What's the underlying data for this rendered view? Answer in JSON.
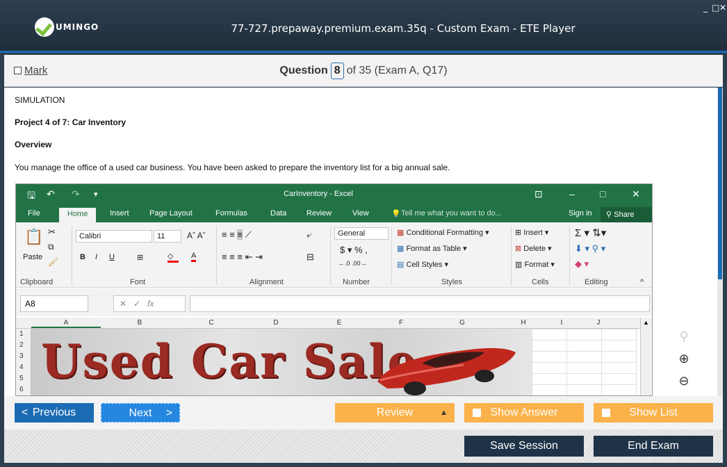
{
  "app": {
    "logo_text": "UMINGO",
    "title": "77-727.prepaway.premium.exam.35q - Custom Exam - ETE Player",
    "window_controls": [
      "_",
      "□",
      "✕"
    ]
  },
  "question_header": {
    "mark_label": "Mark",
    "question_word": "Question",
    "current": "8",
    "rest": "of 35 (Exam A, Q17)"
  },
  "content": {
    "type_label": "SIMULATION",
    "project_title": "Project 4 of 7: Car Inventory",
    "overview_heading": "Overview",
    "overview_text": "You manage the office of a used car business. You have been asked to prepare the inventory list for a big annual sale."
  },
  "excel": {
    "doc_title": "CarInventory - Excel",
    "tabs": [
      "File",
      "Home",
      "Insert",
      "Page Layout",
      "Formulas",
      "Data",
      "Review",
      "View"
    ],
    "tell_me": "Tell me what you want to do...",
    "sign_in": "Sign in",
    "share": "Share",
    "font_name": "Calibri",
    "font_size": "11",
    "number_format": "General",
    "paste": "Paste",
    "conditional_formatting": "Conditional Formatting",
    "format_as_table": "Format as Table",
    "cell_styles": "Cell Styles",
    "insert": "Insert",
    "delete": "Delete",
    "format": "Format",
    "groups": [
      "Clipboard",
      "Font",
      "Alignment",
      "Number",
      "Styles",
      "Cells",
      "Editing"
    ],
    "name_box": "A8",
    "fx": "fx",
    "columns": [
      "A",
      "B",
      "C",
      "D",
      "E",
      "F",
      "G",
      "H",
      "I",
      "J"
    ],
    "rows": [
      "1",
      "2",
      "3",
      "4",
      "5",
      "6"
    ],
    "banner_text": "Used Car Sale"
  },
  "nav": {
    "previous": "Previous",
    "next": "Next",
    "review": "Review",
    "show_answer": "Show Answer",
    "show_list": "Show List",
    "save_session": "Save Session",
    "end_exam": "End Exam"
  },
  "colors": {
    "title_bar": "#2f3f50",
    "accent_blue": "#1b6bb3",
    "excel_green": "#217346",
    "orange": "#fbb24b",
    "dark_button": "#1f3347"
  }
}
